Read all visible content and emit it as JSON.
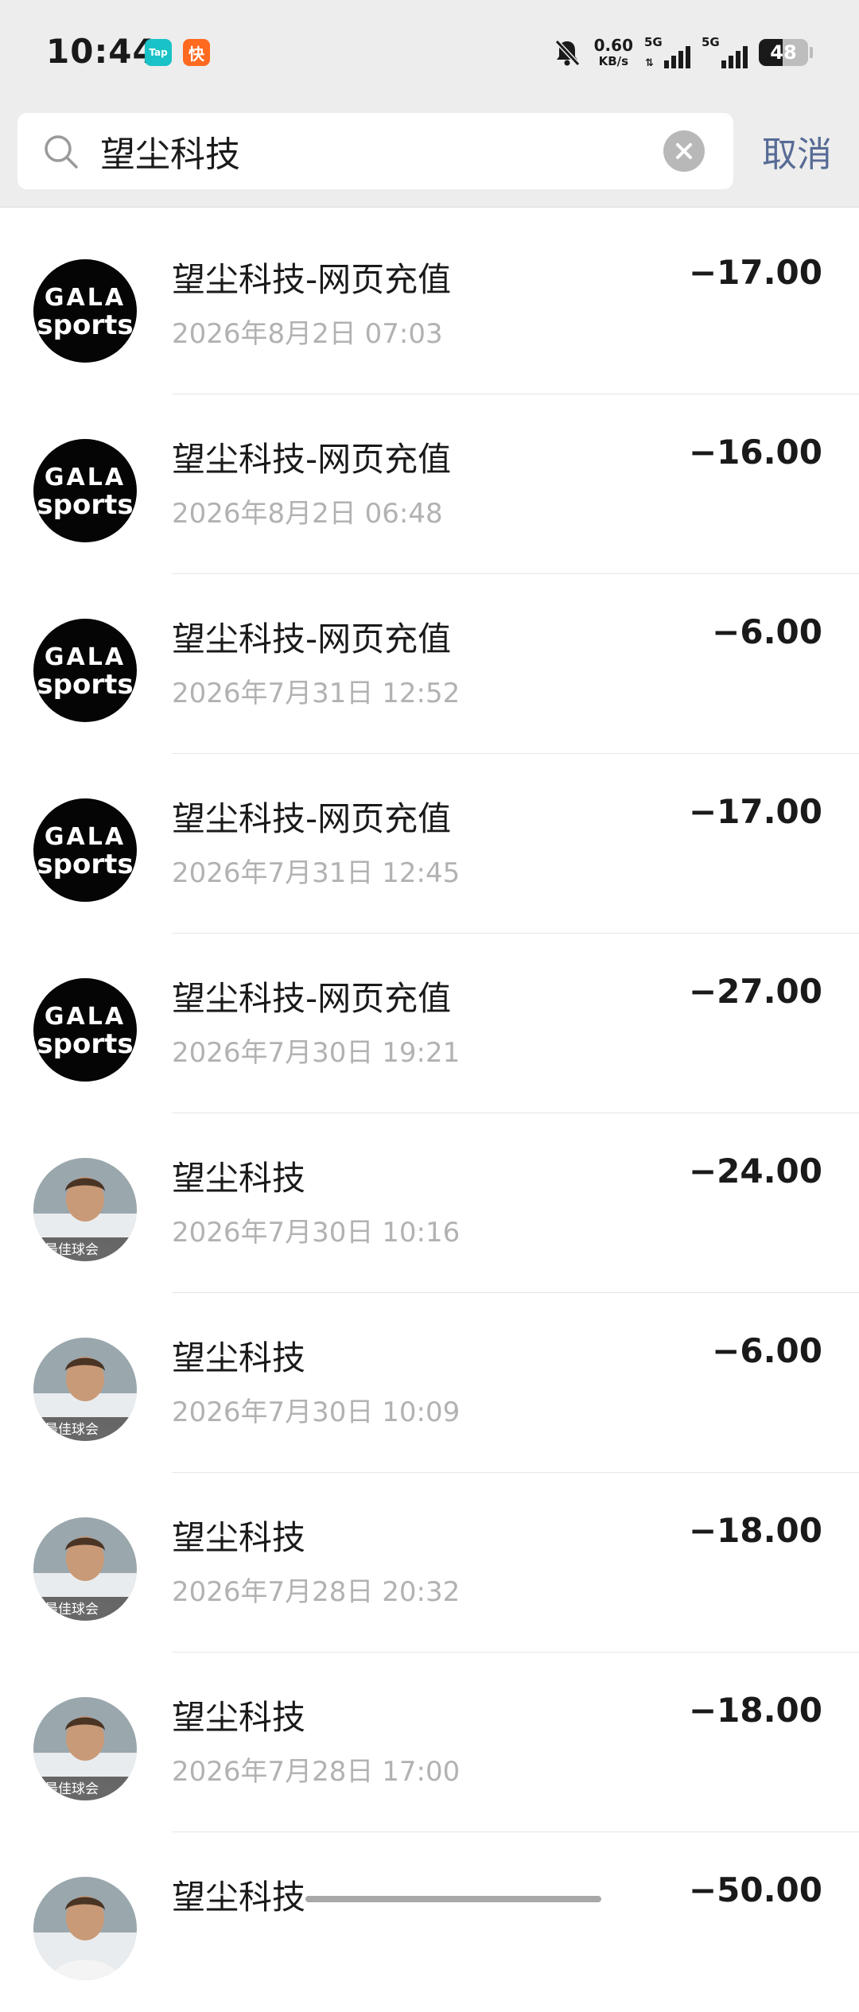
{
  "status_bar": {
    "time": "10:44",
    "app_badges": [
      "Tap",
      "快"
    ],
    "icons": [
      "mute-bell-icon"
    ],
    "net_speed": "0.60",
    "net_speed_unit": "KB/s",
    "signal_1": "5G",
    "signal_2": "5G",
    "battery_level": "48"
  },
  "search": {
    "query": "望尘科技",
    "cancel_label": "取消"
  },
  "transactions": [
    {
      "title": "望尘科技-网页充值",
      "date": "2026年8月2日 07:03",
      "amount": "−17.00",
      "avatar": "gala"
    },
    {
      "title": "望尘科技-网页充值",
      "date": "2026年8月2日 06:48",
      "amount": "−16.00",
      "avatar": "gala"
    },
    {
      "title": "望尘科技-网页充值",
      "date": "2026年7月31日 12:52",
      "amount": "−6.00",
      "avatar": "gala"
    },
    {
      "title": "望尘科技-网页充值",
      "date": "2026年7月31日 12:45",
      "amount": "−17.00",
      "avatar": "gala"
    },
    {
      "title": "望尘科技-网页充值",
      "date": "2026年7月30日 19:21",
      "amount": "−27.00",
      "avatar": "gala"
    },
    {
      "title": "望尘科技",
      "date": "2026年7月30日 10:16",
      "amount": "−24.00",
      "avatar": "player"
    },
    {
      "title": "望尘科技",
      "date": "2026年7月30日 10:09",
      "amount": "−6.00",
      "avatar": "player"
    },
    {
      "title": "望尘科技",
      "date": "2026年7月28日 20:32",
      "amount": "−18.00",
      "avatar": "player"
    },
    {
      "title": "望尘科技",
      "date": "2026年7月28日 17:00",
      "amount": "−18.00",
      "avatar": "player"
    },
    {
      "title": "望尘科技",
      "date": "",
      "amount": "−50.00",
      "avatar": "player"
    }
  ],
  "avatars": {
    "gala_top": "GALA",
    "gala_bottom": "sports",
    "player_caption": "最佳球会"
  }
}
